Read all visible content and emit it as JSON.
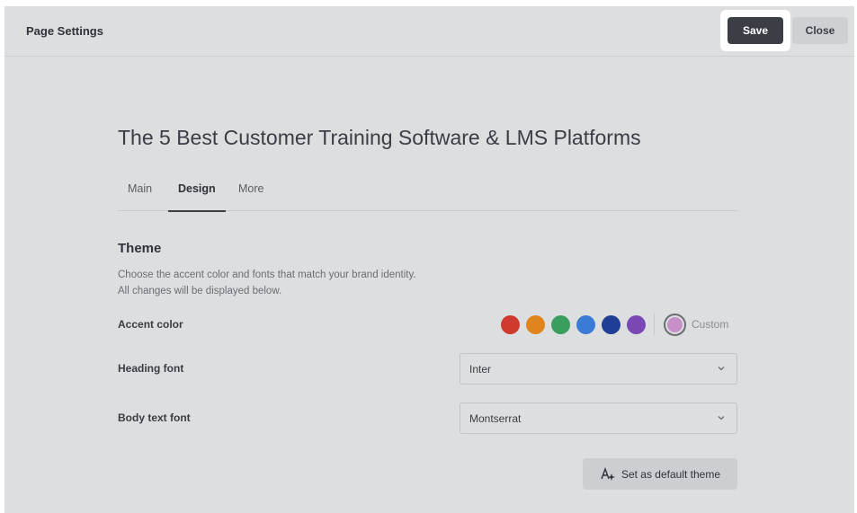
{
  "header": {
    "title": "Page Settings",
    "save_label": "Save",
    "close_label": "Close"
  },
  "page": {
    "title": "The 5 Best Customer Training Software & LMS Platforms"
  },
  "tabs": [
    {
      "label": "Main",
      "active": false
    },
    {
      "label": "Design",
      "active": true
    },
    {
      "label": "More",
      "active": false
    }
  ],
  "theme": {
    "title": "Theme",
    "description_line1": "Choose the accent color and fonts that match your brand identity.",
    "description_line2": "All changes will be displayed below.",
    "accent_label": "Accent color",
    "accent_colors": [
      "#d0392d",
      "#e0841d",
      "#3a9e5e",
      "#3a7bd5",
      "#1f3f96",
      "#7a48b4"
    ],
    "custom_color": "#c78fc8",
    "custom_label": "Custom",
    "heading_font_label": "Heading font",
    "heading_font_value": "Inter",
    "body_font_label": "Body text font",
    "body_font_value": "Montserrat",
    "default_button_label": "Set as default theme"
  },
  "icons": {
    "chevron": "chevron-down-icon",
    "font_theme": "font-style-icon"
  }
}
